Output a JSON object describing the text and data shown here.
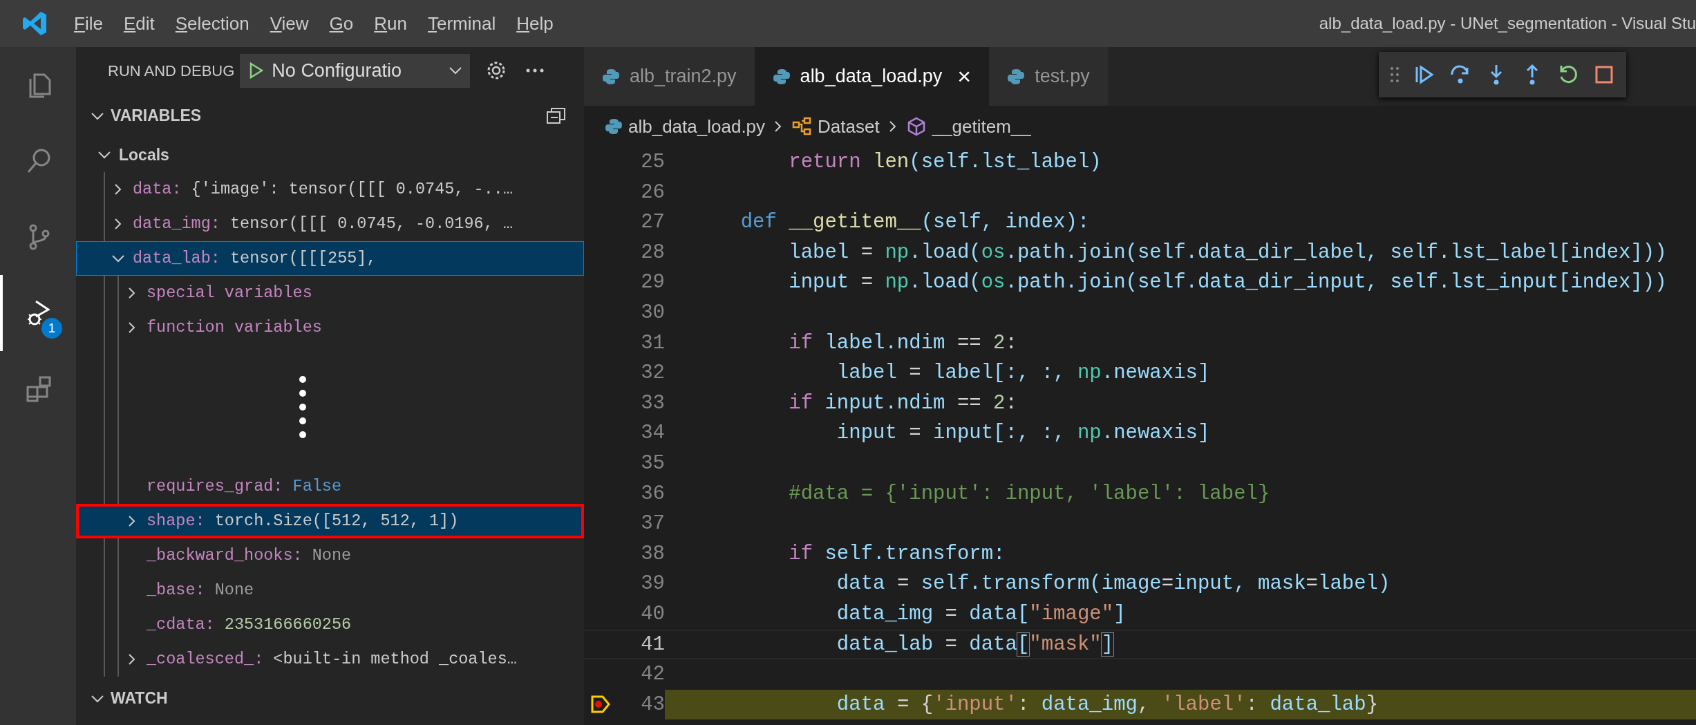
{
  "window": {
    "title": "alb_data_load.py - UNet_segmentation - Visual Stu"
  },
  "menu": [
    "File",
    "Edit",
    "Selection",
    "View",
    "Go",
    "Run",
    "Terminal",
    "Help"
  ],
  "activity_bar": [
    {
      "kind": "files",
      "selected": false
    },
    {
      "kind": "search",
      "selected": false
    },
    {
      "kind": "branch",
      "selected": false
    },
    {
      "kind": "debug",
      "selected": true,
      "badge": "1"
    },
    {
      "kind": "extensions",
      "selected": false
    }
  ],
  "sidebar": {
    "title": "RUN AND DEBUG",
    "configuration": "No Configuratio",
    "variables": {
      "title": "VARIABLES",
      "expanded": true,
      "items": [
        {
          "kind": "scope",
          "name": "Locals",
          "expanded": true,
          "children": [
            {
              "name": "data:",
              "value": "{'image': tensor([[[ 0.0745, -..…",
              "color": "#cccccc",
              "expanded": false,
              "selected": false,
              "focused": false,
              "annotated": false
            },
            {
              "name": "data_img:",
              "value": "tensor([[[ 0.0745, -0.0196, …",
              "color": "#cccccc",
              "expanded": false,
              "selected": false,
              "focused": false,
              "annotated": false
            },
            {
              "name": "data_lab:",
              "value": "tensor([[[255],",
              "color": "#cccccc",
              "expanded": true,
              "selected": true,
              "focused": true,
              "annotated": false,
              "children": [
                {
                  "name": "special variables",
                  "expanded": false,
                  "selected": false,
                  "focused": false,
                  "annotated": false
                },
                {
                  "name": "function variables",
                  "expanded": false,
                  "selected": false,
                  "focused": false,
                  "annotated": false
                },
                {
                  "kind": "elision"
                },
                {
                  "name": "requires_grad:",
                  "value": "False",
                  "color": "#569cd6",
                  "selected": false,
                  "focused": false,
                  "annotated": false
                },
                {
                  "name": "shape:",
                  "value": "torch.Size([512, 512, 1])",
                  "color": "#cccccc",
                  "expanded": false,
                  "selected": true,
                  "focused": false,
                  "annotated": true
                },
                {
                  "name": "_backward_hooks:",
                  "value": "None",
                  "color": "#9d9d9d",
                  "selected": false,
                  "focused": false,
                  "annotated": false
                },
                {
                  "name": "_base:",
                  "value": "None",
                  "color": "#9d9d9d",
                  "selected": false,
                  "focused": false,
                  "annotated": false
                },
                {
                  "name": "_cdata:",
                  "value": "2353166660256",
                  "color": "#b5cea8",
                  "selected": false,
                  "focused": false,
                  "annotated": false
                },
                {
                  "name": "_coalesced_:",
                  "value": "<built-in method _coales…",
                  "color": "#cccccc",
                  "expanded": false,
                  "selected": false,
                  "focused": false,
                  "annotated": false
                }
              ]
            }
          ]
        }
      ]
    },
    "watch": {
      "title": "WATCH",
      "expanded": true
    }
  },
  "tabs": [
    {
      "label": "alb_train2.py",
      "selected": false
    },
    {
      "label": "alb_data_load.py",
      "selected": true,
      "close": "×"
    },
    {
      "label": "test.py",
      "selected": false
    }
  ],
  "breadcrumb": [
    {
      "kind": "file",
      "label": "alb_data_load.py"
    },
    {
      "kind": "class",
      "label": "Dataset"
    },
    {
      "kind": "method",
      "label": "__getitem__"
    }
  ],
  "debug_toolbar": [
    {
      "kind": "continue"
    },
    {
      "kind": "step-over"
    },
    {
      "kind": "step-into"
    },
    {
      "kind": "step-out"
    },
    {
      "kind": "restart"
    },
    {
      "kind": "stop"
    }
  ],
  "code": [
    {
      "number": "25",
      "cursor": false,
      "paused": false,
      "tokens": [
        {
          "text": "        return",
          "kind": "keyword"
        },
        {
          "text": " len",
          "kind": "function"
        },
        {
          "text": "(self.lst_label)",
          "kind": "variable"
        }
      ]
    },
    {
      "number": "26",
      "cursor": false,
      "paused": false
    },
    {
      "number": "27",
      "cursor": false,
      "paused": false,
      "tokens": [
        {
          "text": "    def",
          "kind": "storage"
        },
        {
          "text": " __getitem__",
          "kind": "function"
        },
        {
          "text": "(self, index):",
          "kind": "variable"
        }
      ]
    },
    {
      "number": "28",
      "cursor": false,
      "paused": false,
      "tokens": [
        {
          "text": "        label",
          "kind": "variable"
        },
        {
          "text": " =",
          "kind": "operator"
        },
        {
          "text": " np",
          "kind": "module"
        },
        {
          "text": ".load(",
          "kind": "variable"
        },
        {
          "text": "os",
          "kind": "module"
        },
        {
          "text": ".path.join(self.data_dir_label, self.lst_label[index]))",
          "kind": "variable"
        }
      ]
    },
    {
      "number": "29",
      "cursor": false,
      "paused": false,
      "tokens": [
        {
          "text": "        input",
          "kind": "variable"
        },
        {
          "text": " =",
          "kind": "operator"
        },
        {
          "text": " np",
          "kind": "module"
        },
        {
          "text": ".load(",
          "kind": "variable"
        },
        {
          "text": "os",
          "kind": "module"
        },
        {
          "text": ".path.join(self.data_dir_input, self.lst_input[index]))",
          "kind": "variable"
        }
      ]
    },
    {
      "number": "30",
      "cursor": false,
      "paused": false
    },
    {
      "number": "31",
      "cursor": false,
      "paused": false,
      "tokens": [
        {
          "text": "        if",
          "kind": "keyword"
        },
        {
          "text": " label.ndim",
          "kind": "variable"
        },
        {
          "text": " ==",
          "kind": "operator"
        },
        {
          "text": " 2",
          "kind": "number"
        },
        {
          "text": ":",
          "kind": "operator"
        }
      ]
    },
    {
      "number": "32",
      "cursor": false,
      "paused": false,
      "tokens": [
        {
          "text": "            label",
          "kind": "variable"
        },
        {
          "text": " =",
          "kind": "operator"
        },
        {
          "text": " label[:, :,",
          "kind": "variable"
        },
        {
          "text": " np",
          "kind": "module"
        },
        {
          "text": ".newaxis]",
          "kind": "variable"
        }
      ]
    },
    {
      "number": "33",
      "cursor": false,
      "paused": false,
      "tokens": [
        {
          "text": "        if",
          "kind": "keyword"
        },
        {
          "text": " input.ndim",
          "kind": "variable"
        },
        {
          "text": " ==",
          "kind": "operator"
        },
        {
          "text": " 2",
          "kind": "number"
        },
        {
          "text": ":",
          "kind": "operator"
        }
      ]
    },
    {
      "number": "34",
      "cursor": false,
      "paused": false,
      "tokens": [
        {
          "text": "            input",
          "kind": "variable"
        },
        {
          "text": " =",
          "kind": "operator"
        },
        {
          "text": " input[:, :,",
          "kind": "variable"
        },
        {
          "text": " np",
          "kind": "module"
        },
        {
          "text": ".newaxis]",
          "kind": "variable"
        }
      ]
    },
    {
      "number": "35",
      "cursor": false,
      "paused": false
    },
    {
      "number": "36",
      "cursor": false,
      "paused": false,
      "tokens": [
        {
          "text": "        #data = {'input': input, 'label': label}",
          "kind": "comment"
        }
      ]
    },
    {
      "number": "37",
      "cursor": false,
      "paused": false
    },
    {
      "number": "38",
      "cursor": false,
      "paused": false,
      "tokens": [
        {
          "text": "        if",
          "kind": "keyword"
        },
        {
          "text": " self.transform:",
          "kind": "variable"
        }
      ]
    },
    {
      "number": "39",
      "cursor": false,
      "paused": false,
      "tokens": [
        {
          "text": "            data",
          "kind": "variable"
        },
        {
          "text": " =",
          "kind": "operator"
        },
        {
          "text": " self.transform(image",
          "kind": "variable"
        },
        {
          "text": "=",
          "kind": "operator"
        },
        {
          "text": "input, mask",
          "kind": "variable"
        },
        {
          "text": "=",
          "kind": "operator"
        },
        {
          "text": "label)",
          "kind": "variable"
        }
      ]
    },
    {
      "number": "40",
      "cursor": false,
      "paused": false,
      "tokens": [
        {
          "text": "            data_img",
          "kind": "variable"
        },
        {
          "text": " =",
          "kind": "operator"
        },
        {
          "text": " data[",
          "kind": "variable"
        },
        {
          "text": "\"image\"",
          "kind": "string"
        },
        {
          "text": "]",
          "kind": "variable"
        }
      ]
    },
    {
      "number": "41",
      "cursor": true,
      "paused": false,
      "tokens": [
        {
          "text": "            data_lab",
          "kind": "variable"
        },
        {
          "text": " =",
          "kind": "operator"
        },
        {
          "text": " data",
          "kind": "variable"
        },
        {
          "text": "[",
          "kind": "bracket"
        },
        {
          "text": "\"mask\"",
          "kind": "string"
        },
        {
          "text": "]",
          "kind": "bracket"
        }
      ]
    },
    {
      "number": "42",
      "cursor": false,
      "paused": false
    },
    {
      "number": "43",
      "cursor": false,
      "paused": true,
      "tokens": [
        {
          "text": "            data",
          "kind": "variable"
        },
        {
          "text": " = {",
          "kind": "operator"
        },
        {
          "text": "'input'",
          "kind": "string"
        },
        {
          "text": ":",
          "kind": "operator"
        },
        {
          "text": " data_img",
          "kind": "variable"
        },
        {
          "text": ",",
          "kind": "operator"
        },
        {
          "text": " 'label'",
          "kind": "string"
        },
        {
          "text": ":",
          "kind": "operator"
        },
        {
          "text": " data_lab",
          "kind": "variable"
        },
        {
          "text": "}",
          "kind": "operator"
        }
      ]
    }
  ]
}
